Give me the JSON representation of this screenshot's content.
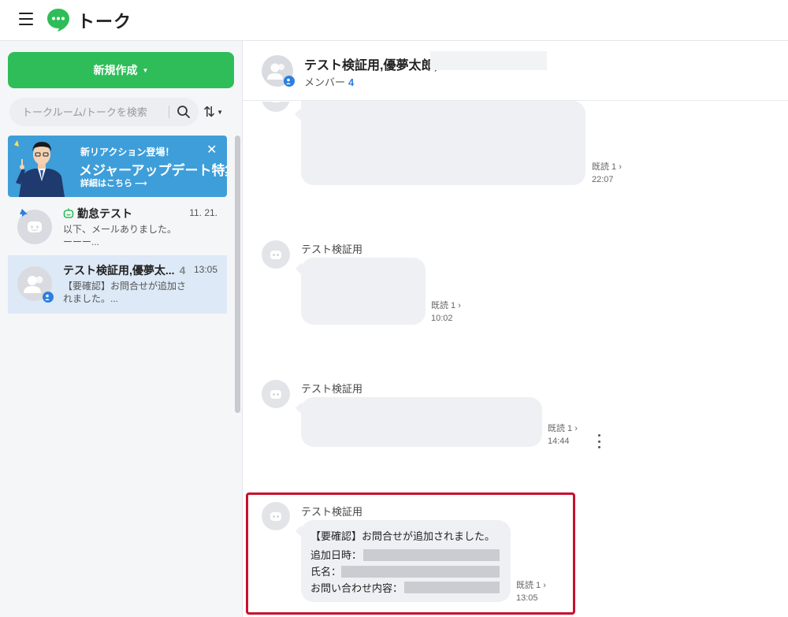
{
  "header": {
    "title": "トーク"
  },
  "sidebar": {
    "new_button": "新規作成",
    "search_placeholder": "トークルーム/トークを検索",
    "banner": {
      "subtitle": "新リアクション登場！",
      "title": "メジャーアップデート特集",
      "link": "詳細はこちら ⟶"
    },
    "chats": [
      {
        "name": "勤怠テスト",
        "count": "",
        "time": "11. 21.",
        "preview": "以下、メールありました。\nーーー..."
      },
      {
        "name": "テスト検証用,優夢太...",
        "count": "4",
        "time": "13:05",
        "preview": "【要確認】お問合せが追加さ\nれました。..."
      }
    ]
  },
  "chat_header": {
    "title": "テスト検証用,優夢太郎,",
    "members_label": "メンバー",
    "members_count": "4"
  },
  "messages": [
    {
      "sender": "",
      "read": "既読 1 ›",
      "time": "22:07"
    },
    {
      "sender": "テスト検証用",
      "read": "既読 1 ›",
      "time": "10:02"
    },
    {
      "sender": "テスト検証用",
      "read": "既読 1 ›",
      "time": "14:44"
    },
    {
      "sender": "テスト検証用",
      "read": "既読 1 ›",
      "time": "13:05",
      "lines": [
        "【要確認】お問合せが追加されました。",
        "追加日時：",
        "氏名：",
        "お問い合わせ内容："
      ]
    }
  ],
  "colors": {
    "brand_green": "#2ebd59",
    "accent_blue": "#2d7fe0",
    "highlight_red": "#c8102e",
    "banner_blue": "#3e9ed9"
  }
}
